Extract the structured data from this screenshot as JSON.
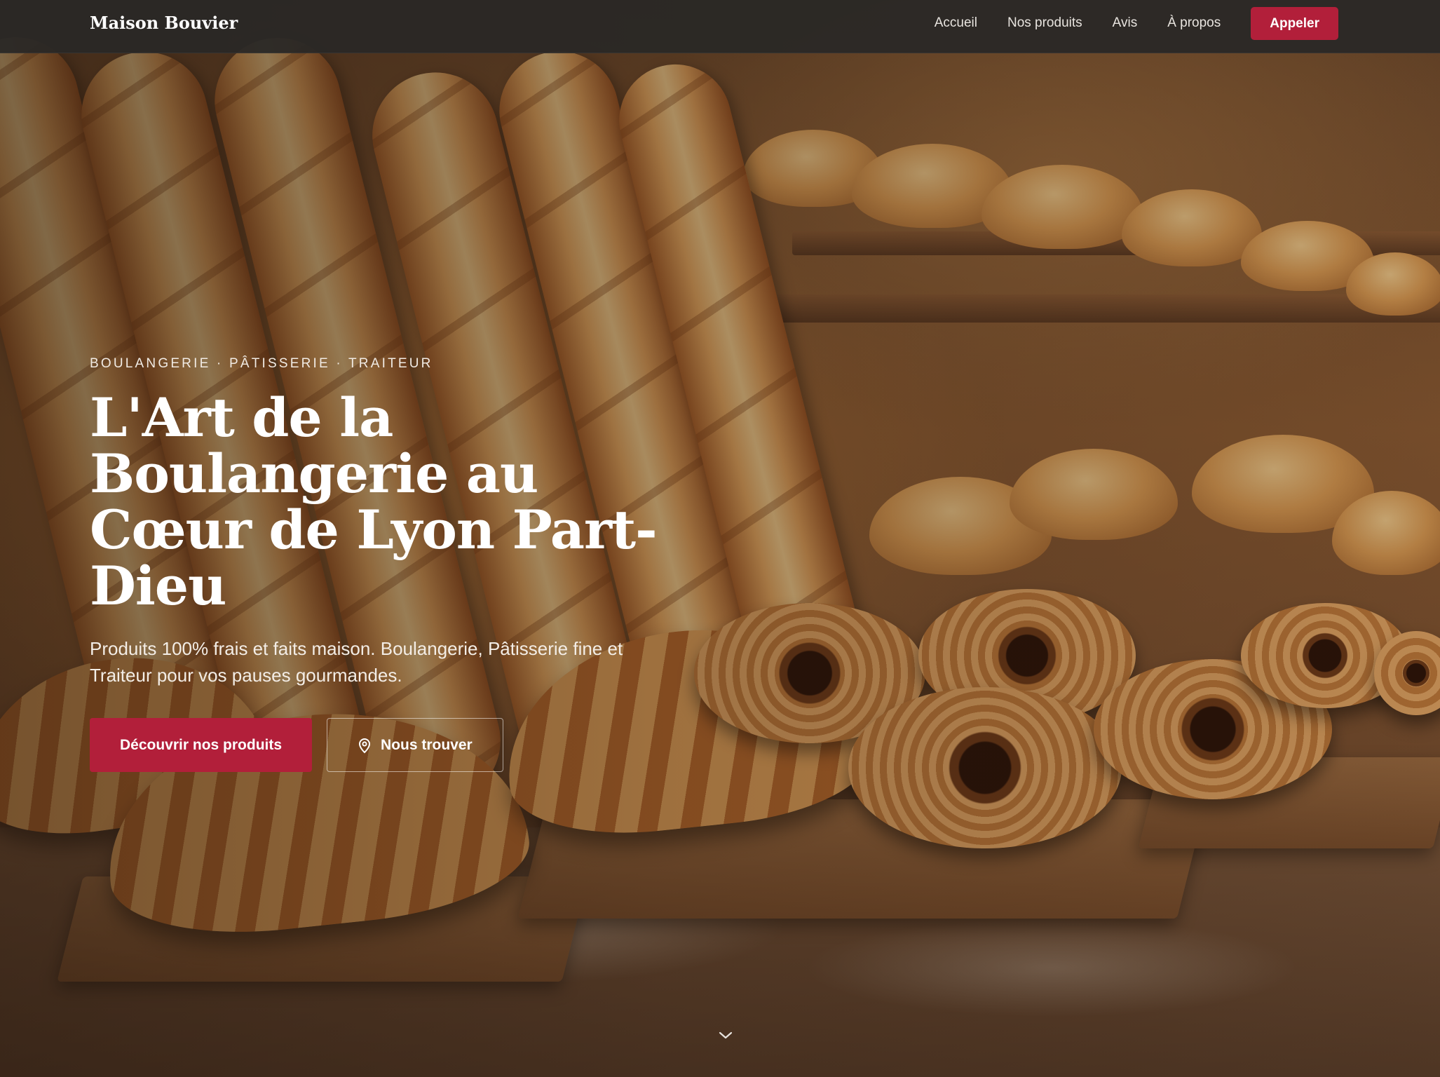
{
  "nav": {
    "brand": "Maison Bouvier",
    "links": [
      "Accueil",
      "Nos produits",
      "Avis",
      "À propos"
    ],
    "cta_label": "Appeler"
  },
  "hero": {
    "eyebrow": "BOULANGERIE · PÂTISSERIE · TRAITEUR",
    "headline": "L'Art de la Boulangerie au Cœur de Lyon Part-Dieu",
    "subtitle": "Produits 100% frais et faits maison. Boulangerie, Pâtisserie fine et Traiteur pour vos pauses gourmandes.",
    "primary_button": "Découvrir nos produits",
    "secondary_button": "Nous trouver",
    "secondary_icon": "map-pin-icon",
    "scroll_icon": "chevron-down-icon"
  },
  "colors": {
    "accent": "#b21f3a",
    "nav_bg": "#2a2826",
    "text": "#ffffff"
  }
}
